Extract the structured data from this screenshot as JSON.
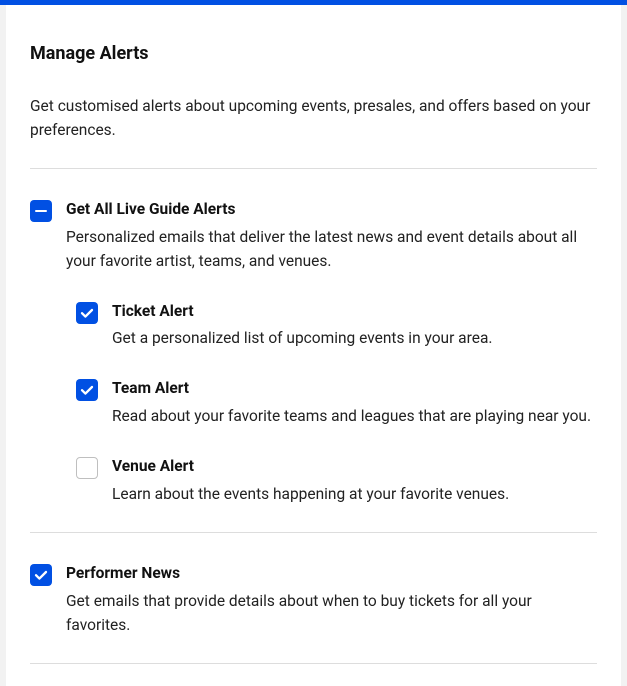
{
  "title": "Manage Alerts",
  "intro": "Get customised alerts about upcoming events, presales, and offers based on your preferences.",
  "groups": [
    {
      "state": "indeterminate",
      "label": "Get All Live Guide Alerts",
      "desc": "Personalized emails that deliver the latest news and event details about all your favorite artist, teams, and venues.",
      "children": [
        {
          "state": "checked",
          "label": "Ticket Alert",
          "desc": "Get a personalized list of upcoming events in your area."
        },
        {
          "state": "checked",
          "label": "Team Alert",
          "desc": "Read about your favorite teams and leagues that are playing near you."
        },
        {
          "state": "unchecked",
          "label": "Venue Alert",
          "desc": "Learn about the events happening at your favorite venues."
        }
      ]
    },
    {
      "state": "checked",
      "label": "Performer News",
      "desc": "Get emails that provide details about when to buy tickets for all your favorites."
    }
  ]
}
